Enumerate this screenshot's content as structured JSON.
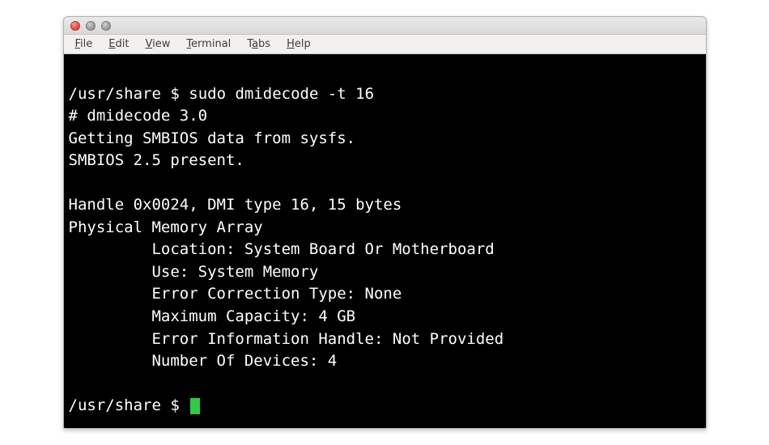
{
  "titlebar": {
    "buttons": [
      "close",
      "minimize",
      "maximize"
    ]
  },
  "menubar": {
    "items": [
      {
        "label": "File",
        "accel": "F"
      },
      {
        "label": "Edit",
        "accel": "E"
      },
      {
        "label": "View",
        "accel": "V"
      },
      {
        "label": "Terminal",
        "accel": "T"
      },
      {
        "label": "Tabs",
        "accel": "a"
      },
      {
        "label": "Help",
        "accel": "H"
      }
    ]
  },
  "terminal": {
    "prompt_path": "/usr/share",
    "prompt_symbol": "$",
    "command": "sudo dmidecode -t 16",
    "output": {
      "version_line": "# dmidecode 3.0",
      "getting_line": "Getting SMBIOS data from sysfs.",
      "smbios_line": "SMBIOS 2.5 present.",
      "handle_line": "Handle 0x0024, DMI type 16, 15 bytes",
      "section_title": "Physical Memory Array",
      "fields": [
        {
          "k": "Location",
          "v": "System Board Or Motherboard"
        },
        {
          "k": "Use",
          "v": "System Memory"
        },
        {
          "k": "Error Correction Type",
          "v": "None"
        },
        {
          "k": "Maximum Capacity",
          "v": "4 GB"
        },
        {
          "k": "Error Information Handle",
          "v": "Not Provided"
        },
        {
          "k": "Number Of Devices",
          "v": "4"
        }
      ]
    },
    "prompt2_path": "/usr/share",
    "prompt2_symbol": "$"
  }
}
